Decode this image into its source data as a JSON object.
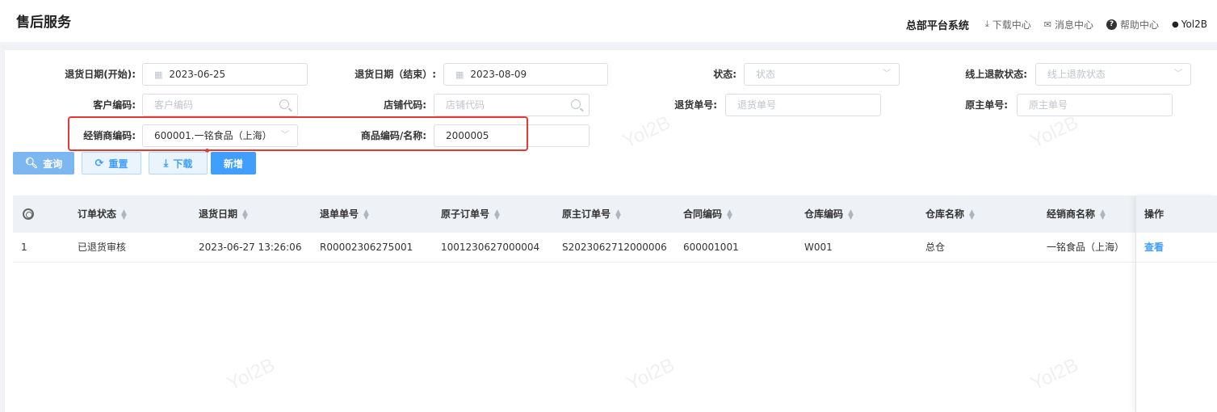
{
  "header": {
    "title": "售后服务",
    "platform": "总部平台系统",
    "links": [
      "下载中心",
      "消息中心",
      "帮助中心"
    ],
    "user": "Yol2B"
  },
  "filters": {
    "return_date_start": {
      "label": "退货日期(开始):",
      "value": "2023-06-25"
    },
    "return_date_end": {
      "label": "退货日期（结束）:",
      "value": "2023-08-09"
    },
    "status": {
      "label": "状态:",
      "placeholder": "状态"
    },
    "refund_status": {
      "label": "线上退款状态:",
      "placeholder": "线上退款状态"
    },
    "customer_code": {
      "label": "客户编码:",
      "placeholder": "客户编码"
    },
    "store_code": {
      "label": "店铺代码:",
      "placeholder": "店铺代码"
    },
    "return_no": {
      "label": "退货单号:",
      "placeholder": "退货单号"
    },
    "original_main_no": {
      "label": "原主单号:",
      "placeholder": "原主单号"
    },
    "dealer_code": {
      "label": "经销商编码:",
      "value": "600001.一铭食品（上海）"
    },
    "product": {
      "label": "商品编码/名称:",
      "value": "2000005"
    }
  },
  "buttons": {
    "query": "查询",
    "reset": "重置",
    "download": "下载",
    "add": "新增"
  },
  "table": {
    "columns": [
      "订单状态",
      "退货日期",
      "退单单号",
      "原子订单号",
      "原主订单号",
      "合同编码",
      "仓库编码",
      "仓库名称",
      "经销商名称",
      "操作"
    ],
    "rows": [
      {
        "index": "1",
        "order_status": "已退货审核",
        "return_date": "2023-06-27 13:26:06",
        "return_no": "R00002306275001",
        "sub_order_no": "1001230627000004",
        "main_order_no": "S2023062712000006",
        "contract_code": "600001001",
        "warehouse_code": "W001",
        "warehouse_name": "总仓",
        "dealer_name": "一铭食品（上海）",
        "action": "查看"
      }
    ]
  },
  "watermark": "Yol2B",
  "colors": {
    "primary": "#409eff",
    "highlight": "#e53935"
  }
}
